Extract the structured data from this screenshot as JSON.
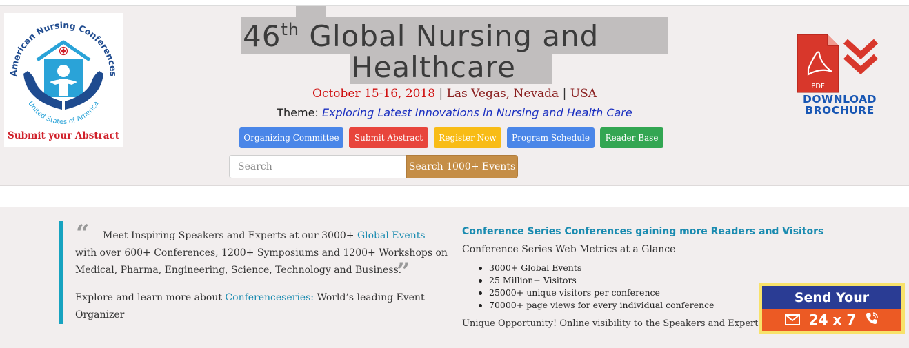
{
  "logo": {
    "arc_text": "American Nursing Conferences",
    "bottom_text": "United States of America",
    "cta": "Submit your Abstract"
  },
  "title": {
    "number": "46",
    "suffix": "th",
    "line1_rest": " Global Nursing and",
    "line2": "Healthcare"
  },
  "event": {
    "date": "October 15-16, 2018",
    "separator": "|",
    "city": "Las Vegas, Nevada",
    "country": "USA",
    "theme_label": "Theme:",
    "theme_text": "Exploring Latest Innovations in Nursing and Health Care"
  },
  "nav": {
    "buttons": [
      {
        "label": "Organizing Committee",
        "color": "#4a86e8"
      },
      {
        "label": "Submit Abstract",
        "color": "#e8453c"
      },
      {
        "label": "Register Now",
        "color": "#f8bc16"
      },
      {
        "label": "Program Schedule",
        "color": "#4a86e8"
      },
      {
        "label": "Reader Base",
        "color": "#33a652"
      }
    ]
  },
  "search": {
    "placeholder": "Search",
    "button_label": "Search 1000+ Events"
  },
  "brochure": {
    "pdf_label": "PDF",
    "line1": "DOWNLOAD",
    "line2": "BROCHURE"
  },
  "quote": {
    "open_mark": "“",
    "close_mark": "”",
    "line1_pre": "Meet Inspiring Speakers and Experts at our 3000+ ",
    "line1_link": "Global Events",
    "line2": "with over 600+ Conferences, 1200+ Symposiums and 1200+ Workshops on",
    "line3": "Medical, Pharma, Engineering, Science, Technology and Business.",
    "explore_pre": "Explore and learn more about ",
    "explore_link": "Conferenceseries:",
    "explore_post": " World’s leading Event",
    "explore_line2": "Organizer"
  },
  "metrics": {
    "title": "Conference Series Conferences gaining more Readers and Visitors",
    "subtitle": "Conference Series Web Metrics at a Glance",
    "items": [
      "3000+ Global Events",
      "25 Million+ Visitors",
      "25000+ unique visitors per conference",
      "70000+ page views for every individual conference"
    ],
    "footer": "Unique Opportunity! Online visibility to the Speakers and Experts"
  },
  "message_widget": {
    "title": "Send Your Message",
    "availability": "24 x 7",
    "mail_icon": "mail-icon",
    "phone_icon": "phone-icon"
  }
}
